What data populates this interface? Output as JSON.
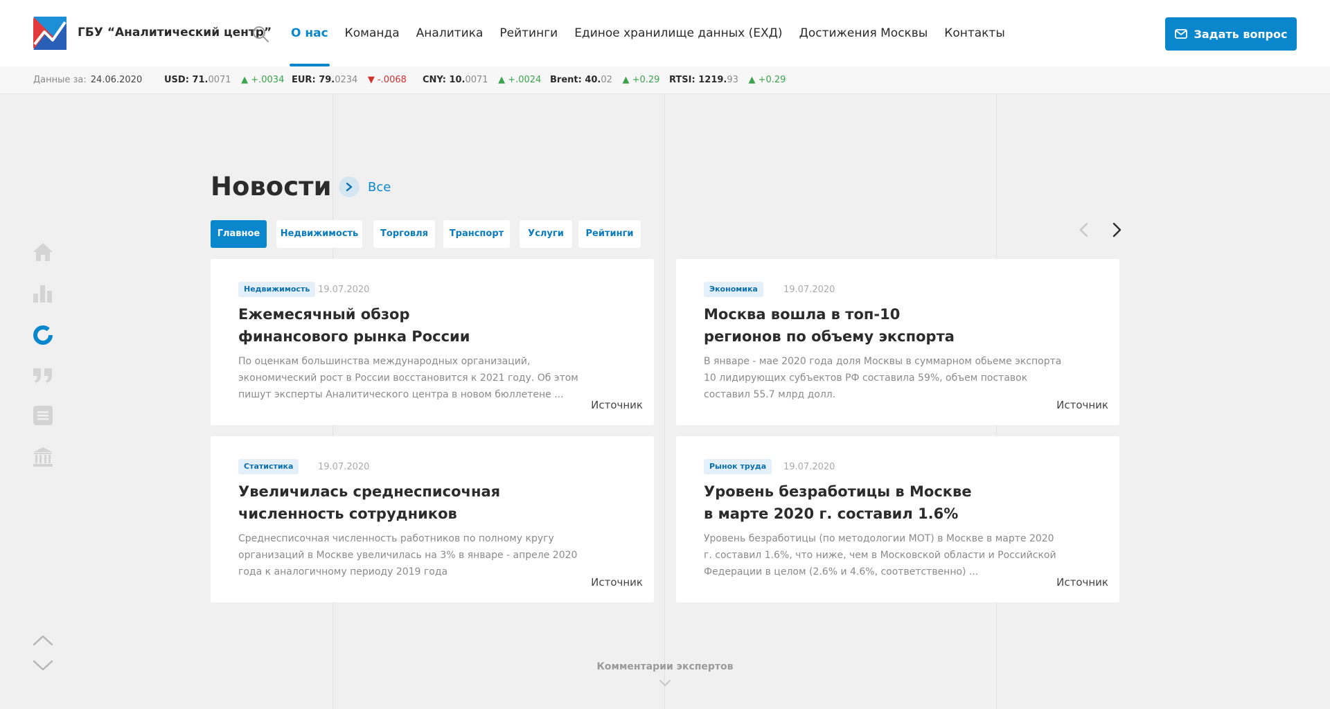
{
  "brand": {
    "name": "ГБУ “Аналитический центр”"
  },
  "nav": {
    "items": [
      {
        "label": "О нас",
        "active": true
      },
      {
        "label": "Команда"
      },
      {
        "label": "Аналитика"
      },
      {
        "label": "Рейтинги"
      },
      {
        "label": "Единое хранилище данных (ЕХД)"
      },
      {
        "label": "Достижения Москвы"
      },
      {
        "label": "Контакты"
      }
    ],
    "ask_button": "Задать вопрос"
  },
  "ticker": {
    "date_label": "Данные за:",
    "date": "24.06.2020",
    "items": [
      {
        "name": "USD:",
        "main": "71.",
        "frac": "0071",
        "change": "▲ +.0034",
        "dir": "up"
      },
      {
        "name": "EUR:",
        "main": "79.",
        "frac": "0234",
        "change": "▼ -.0068",
        "dir": "down"
      },
      {
        "name": "CNY:",
        "main": "10.",
        "frac": "0071",
        "change": "▲ +.0024",
        "dir": "up"
      },
      {
        "name": "Brent:",
        "main": "40.",
        "frac": "02",
        "change": "▲ +0.29",
        "dir": "up"
      },
      {
        "name": "RTSI:",
        "main": "1219.",
        "frac": "93",
        "change": "▲ +0.29",
        "dir": "up"
      }
    ]
  },
  "news": {
    "title": "Новости",
    "all_label": "Все",
    "tabs": [
      "Главное",
      "Недвижимость",
      "Торговля",
      "Транспорт",
      "Услуги",
      "Рейтинги"
    ],
    "source_label": "Источник",
    "cards": [
      {
        "badge": "Недвижимость",
        "date": "19.07.2020",
        "title": "Ежемесячный обзор финансового рынка России",
        "text": "По оценкам большинства международных организаций, экономический рост в России восстановится к 2021 году. Об этом пишут эксперты Аналитического центра в новом бюллетене ..."
      },
      {
        "badge": "Экономика",
        "date": "19.07.2020",
        "title": "Москва вошла в топ-10 регионов по объему экспорта",
        "text": "В январе - мае 2020 года доля Москвы в суммарном обьеме экспорта 10 лидирующих субъектов РФ составила 59%, объем поставок составил 55.7 млрд долл."
      },
      {
        "badge": "Статистика",
        "date": "19.07.2020",
        "title": "Увеличилась среднесписочная численность сотрудников",
        "text": "Среднесписочная численность работников по полному кругу организаций в Москве увеличилась на 3% в январе - апреле 2020 года к аналогичному периоду 2019 года"
      },
      {
        "badge": "Рынок труда",
        "date": "19.07.2020",
        "title": "Уровень безработицы в Москве в марте 2020 г. составил 1.6%",
        "text": "Уровень безработицы (по методологии МОТ) в Москве в марте 2020 г. составил 1.6%, что ниже, чем в Московской области и Российской Федерации в целом (2.6% и 4.6%, соответственно) ..."
      }
    ]
  },
  "next_section": "Комментарии экспертов",
  "colors": {
    "accent": "#0a87cc",
    "up": "#3aa34b",
    "down": "#d22f2f"
  }
}
